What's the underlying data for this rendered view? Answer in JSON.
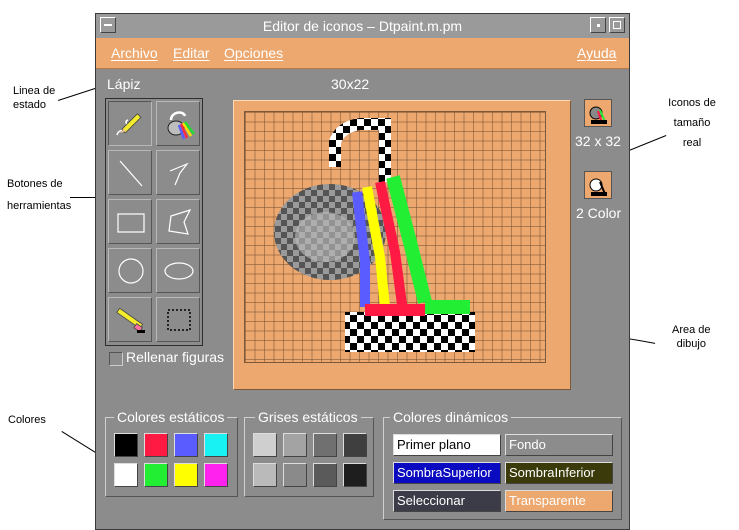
{
  "window": {
    "title": "Editor de iconos – Dtpaint.m.pm"
  },
  "menubar": {
    "archivo": "Archivo",
    "editar": "Editar",
    "opciones": "Opciones",
    "ayuda": "Ayuda"
  },
  "status": {
    "tool": "Lápiz",
    "size": "30x22"
  },
  "callouts": {
    "status_line": [
      "Linea de",
      "estado"
    ],
    "tool_buttons": [
      "Botones de",
      "herramientas"
    ],
    "colors": "Colores",
    "real_icons": [
      "Iconos de",
      "tamaño",
      "real"
    ],
    "drawing_area": [
      "Area de",
      "dibujo"
    ]
  },
  "tools": [
    "pencil",
    "bucket-fill",
    "line",
    "polyline",
    "rectangle",
    "polygon",
    "circle",
    "ellipse",
    "eraser",
    "select"
  ],
  "fill_shapes": "Rellenar figuras",
  "real_icons": {
    "large": "32 x 32",
    "small": "2 Color"
  },
  "static_colors": {
    "title": "Colores estáticos",
    "colors": [
      "#000000",
      "#ff1a44",
      "#5a5cff",
      "#18f2f2",
      "#ffffff",
      "#22ee33",
      "#ffff00",
      "#ff22ee"
    ]
  },
  "static_greys": {
    "title": "Grises estáticos",
    "colors": [
      "#cfcfcf",
      "#a3a3a3",
      "#707070",
      "#3f3f3f",
      "#bababa",
      "#8a8a8a",
      "#5a5a5a",
      "#1e1e1e"
    ]
  },
  "dynamic_colors": {
    "title": "Colores dinámicos",
    "items": [
      {
        "label": "Primer plano",
        "bg": "#ffffff",
        "fg": "#000000"
      },
      {
        "label": "Fondo",
        "bg": "#8c8c8c",
        "fg": "#ffffff"
      },
      {
        "label": "SombraSuperior",
        "bg": "#0a0ac0",
        "fg": "#ffffff"
      },
      {
        "label": "SombraInferior",
        "bg": "#3a3a0a",
        "fg": "#ffffff"
      },
      {
        "label": "Seleccionar",
        "bg": "#3c3c48",
        "fg": "#ffffff"
      },
      {
        "label": "Transparente",
        "bg": "#eca86f",
        "fg": "#ffffff"
      }
    ]
  },
  "colors": {
    "menu_bg": "#eca86f",
    "window_bg": "#8c8c8c",
    "canvas_bg": "#eca86f"
  }
}
